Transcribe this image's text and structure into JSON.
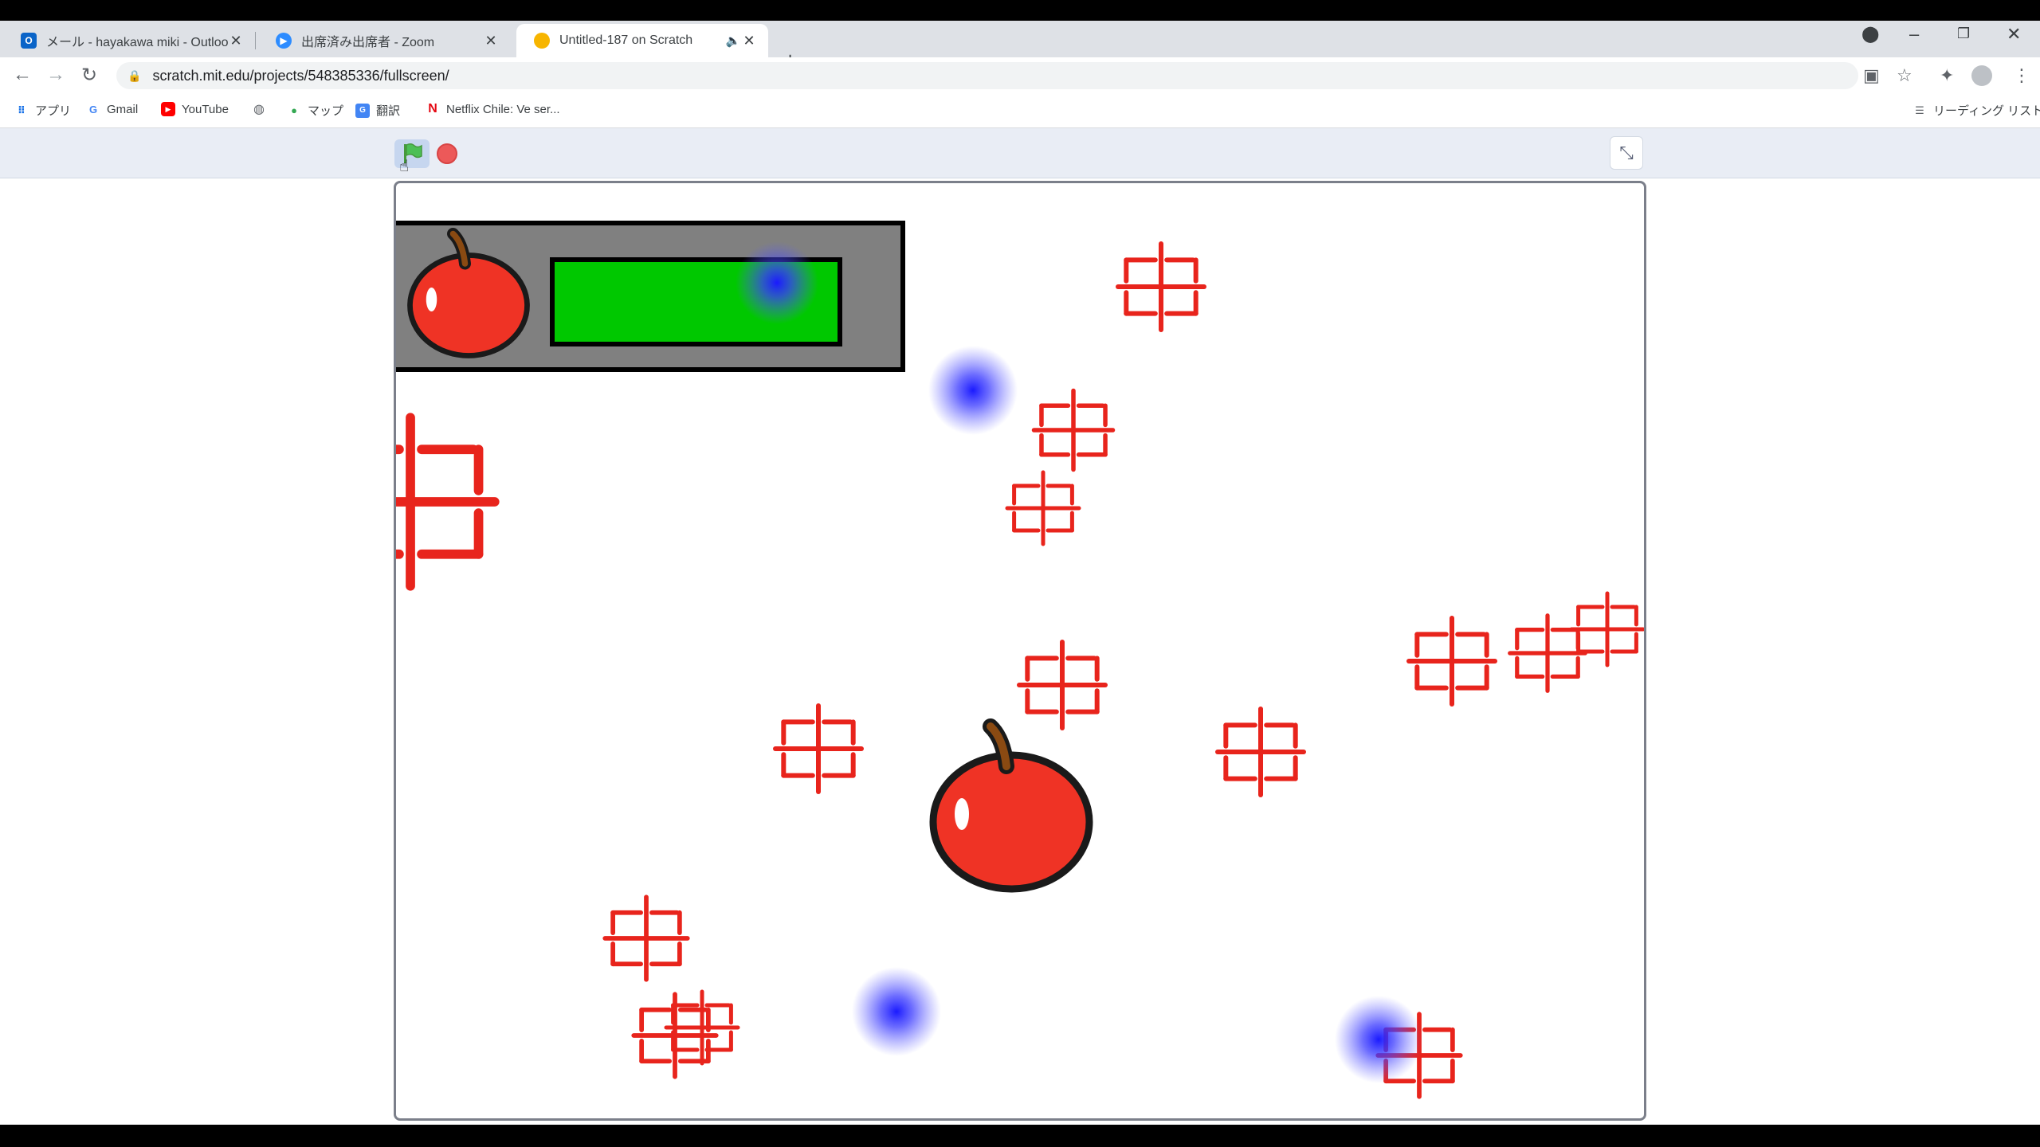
{
  "browser": {
    "tabs": [
      {
        "title": "メール - hayakawa miki - Outlook",
        "icon": "outlook-icon",
        "active": false
      },
      {
        "title": "出席済み出席者 - Zoom",
        "icon": "zoom-icon",
        "active": false
      },
      {
        "title": "Untitled-187 on Scratch",
        "icon": "scratch-icon",
        "active": true
      }
    ],
    "new_tab_label": "+",
    "address": "scratch.mit.edu/projects/548385336/fullscreen/",
    "bookmarks": [
      {
        "label": "アプリ",
        "icon": "apps-grid-icon"
      },
      {
        "label": "Gmail",
        "icon": "google-icon"
      },
      {
        "label": "YouTube",
        "icon": "youtube-icon"
      },
      {
        "label": "",
        "icon": "globe-icon"
      },
      {
        "label": "マップ",
        "icon": "maps-pin-icon"
      },
      {
        "label": "翻訳",
        "icon": "translate-icon"
      },
      {
        "label": "Netflix Chile: Ve ser...",
        "icon": "netflix-icon"
      }
    ],
    "reading_list": "リーディング リスト"
  },
  "scratch": {
    "controls": [
      "green-flag",
      "stop",
      "exit-fullscreen"
    ],
    "health_bar_fill": 1.0,
    "colors": {
      "bar_fill": "#00c800",
      "target_red": "#e8241c",
      "apple_red": "#ef3325",
      "glow": "#2222ff"
    }
  }
}
